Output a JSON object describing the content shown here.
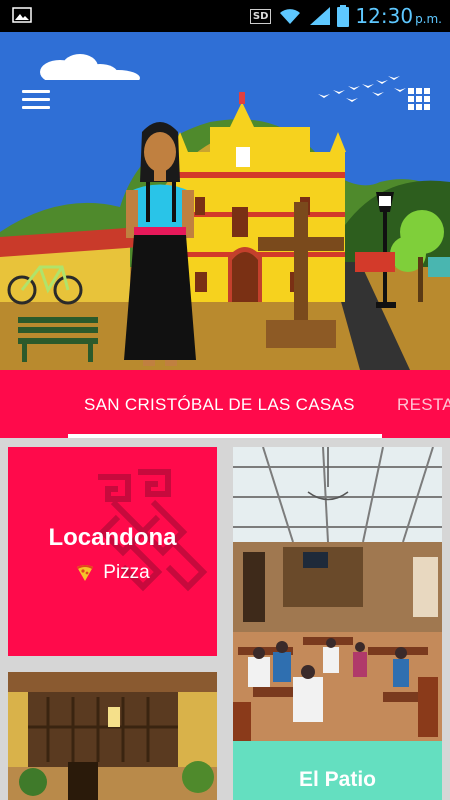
{
  "status_bar": {
    "sd_label": "SD",
    "time": "12:30",
    "ampm": "p.m.",
    "icons": [
      "gallery-icon",
      "sd-card-icon",
      "wifi-icon",
      "signal-icon",
      "battery-icon"
    ]
  },
  "hero": {
    "icons": [
      "menu-icon",
      "grid-icon"
    ]
  },
  "tabs": {
    "items": [
      {
        "label": "SAN CRISTÓBAL DE LAS CASAS",
        "selected": true
      },
      {
        "label": "RESTA",
        "selected": false
      }
    ]
  },
  "cards": [
    {
      "title": "Locandona",
      "category": "Pizza",
      "category_icon": "pizza-icon",
      "color": "#ff0a4b"
    },
    {
      "title": "El Patio",
      "color": "#64dfc0"
    },
    {
      "title": "",
      "color": "#6b4a2a"
    }
  ],
  "colors": {
    "accent": "#ff0a4b",
    "status_bar": "#000000",
    "background": "#d6d6d6",
    "teal": "#64dfc0"
  }
}
